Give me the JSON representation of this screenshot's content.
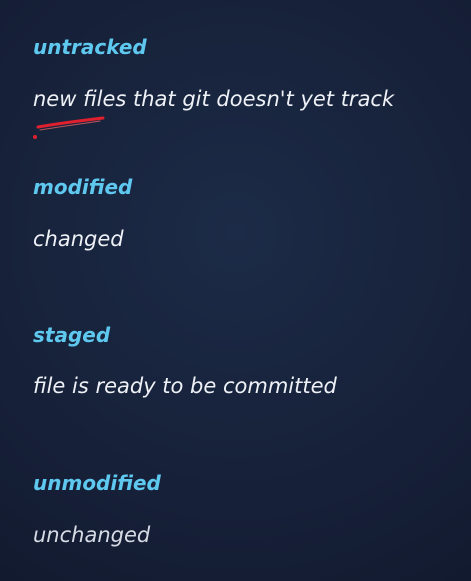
{
  "items": [
    {
      "term": "untracked",
      "description": "new files that git doesn't yet track"
    },
    {
      "term": "modified",
      "description": "changed"
    },
    {
      "term": "staged",
      "description": "file is ready to be committed"
    },
    {
      "term": "unmodified",
      "description": "unchanged"
    }
  ],
  "colors": {
    "background": "#17223a",
    "term": "#5ec8ef",
    "description": "#eef1f6",
    "annotation": "#e0202e"
  }
}
